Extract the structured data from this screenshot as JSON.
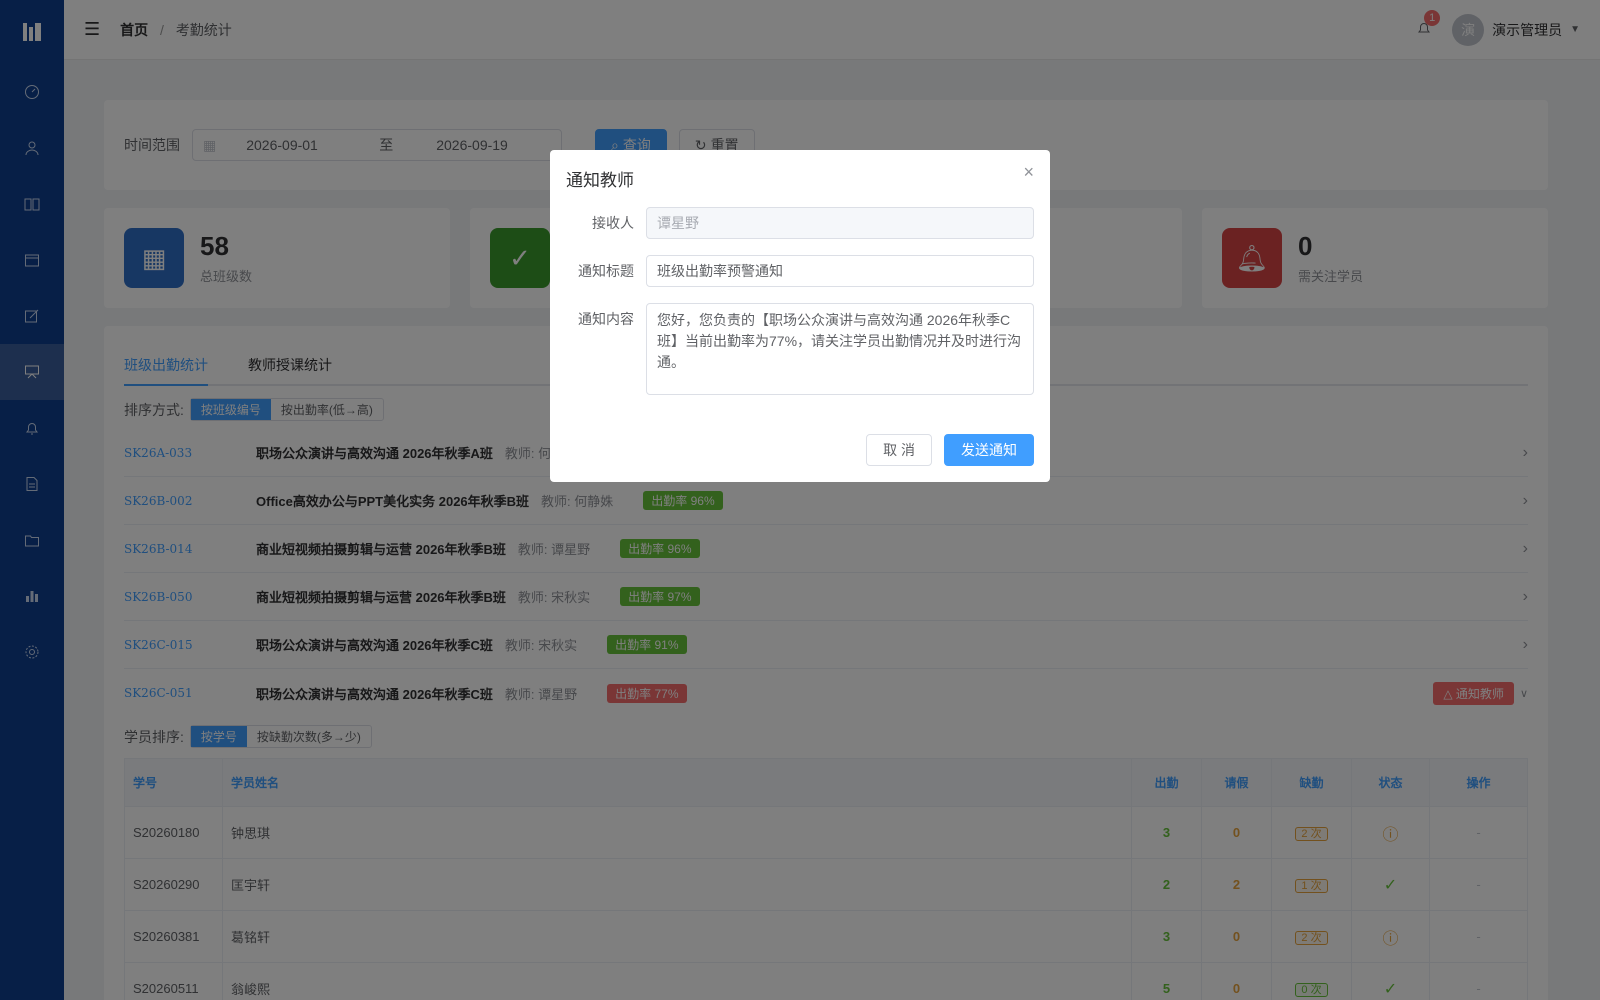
{
  "header": {
    "breadcrumb_home": "首页",
    "breadcrumb_sep": "/",
    "breadcrumb_current": "考勤统计",
    "notification_count": "1",
    "avatar_text": "演",
    "username": "演示管理员"
  },
  "filter": {
    "label": "时间范围",
    "start_date": "2026-09-01",
    "range_sep": "至",
    "end_date": "2026-09-19",
    "query_label": "查询",
    "reset_label": "重置"
  },
  "stats": [
    {
      "value": "58",
      "label": "总班级数",
      "color": "#2f6ec7",
      "icon": "calendar-icon"
    },
    {
      "value": "",
      "label": "",
      "color": "#3b9a2c",
      "icon": "check-icon"
    },
    {
      "value": "",
      "label": "",
      "color": "#e6a23c",
      "icon": "hidden"
    },
    {
      "value": "0",
      "label": "需关注学员",
      "color": "#d64545",
      "icon": "bell-icon"
    }
  ],
  "tabs": [
    "班级出勤统计",
    "教师授课统计"
  ],
  "sort": {
    "label": "排序方式:",
    "options": [
      "按班级编号",
      "按出勤率(低→高)"
    ]
  },
  "classes": [
    {
      "code": "SK26A-033",
      "name": "职场公众演讲与高效沟通 2026年秋季A班",
      "teacher": "教师: 何",
      "rate": ""
    },
    {
      "code": "SK26B-002",
      "name": "Office高效办公与PPT美化实务 2026年秋季B班",
      "teacher": "教师: 何静姝",
      "rate": "出勤率 96%"
    },
    {
      "code": "SK26B-014",
      "name": "商业短视频拍摄剪辑与运营 2026年秋季B班",
      "teacher": "教师: 谭星野",
      "rate": "出勤率 96%"
    },
    {
      "code": "SK26B-050",
      "name": "商业短视频拍摄剪辑与运营 2026年秋季B班",
      "teacher": "教师: 宋秋实",
      "rate": "出勤率 97%"
    },
    {
      "code": "SK26C-015",
      "name": "职场公众演讲与高效沟通 2026年秋季C班",
      "teacher": "教师: 宋秋实",
      "rate": "出勤率 91%"
    },
    {
      "code": "SK26C-051",
      "name": "职场公众演讲与高效沟通 2026年秋季C班",
      "teacher": "教师: 谭星野",
      "rate": "出勤率 77%",
      "notify": "通知教师"
    }
  ],
  "student_sort": {
    "label": "学员排序:",
    "options": [
      "按学号",
      "按缺勤次数(多→少)"
    ]
  },
  "table": {
    "headers": [
      "学号",
      "学员姓名",
      "出勤",
      "请假",
      "缺勤",
      "状态",
      "操作"
    ],
    "rows": [
      {
        "id": "S20260180",
        "name": "钟思琪",
        "present": "3",
        "leave": "0",
        "absent": "2 次",
        "status": "warn",
        "op": "-"
      },
      {
        "id": "S20260290",
        "name": "匡宇轩",
        "present": "2",
        "leave": "2",
        "absent": "1 次",
        "status": "ok",
        "op": "-"
      },
      {
        "id": "S20260381",
        "name": "葛铭轩",
        "present": "3",
        "leave": "0",
        "absent": "2 次",
        "status": "warn",
        "op": "-"
      },
      {
        "id": "S20260511",
        "name": "翁峻熙",
        "present": "5",
        "leave": "0",
        "absent": "0 次",
        "status": "ok",
        "op": "-"
      }
    ]
  },
  "modal": {
    "title": "通知教师",
    "recipient_label": "接收人",
    "recipient_value": "谭星野",
    "subject_label": "通知标题",
    "subject_value": "班级出勤率预警通知",
    "content_label": "通知内容",
    "content_value": "您好，您负责的【职场公众演讲与高效沟通 2026年秋季C班】当前出勤率为77%，请关注学员出勤情况并及时进行沟通。",
    "cancel_label": "取 消",
    "send_label": "发送通知"
  }
}
